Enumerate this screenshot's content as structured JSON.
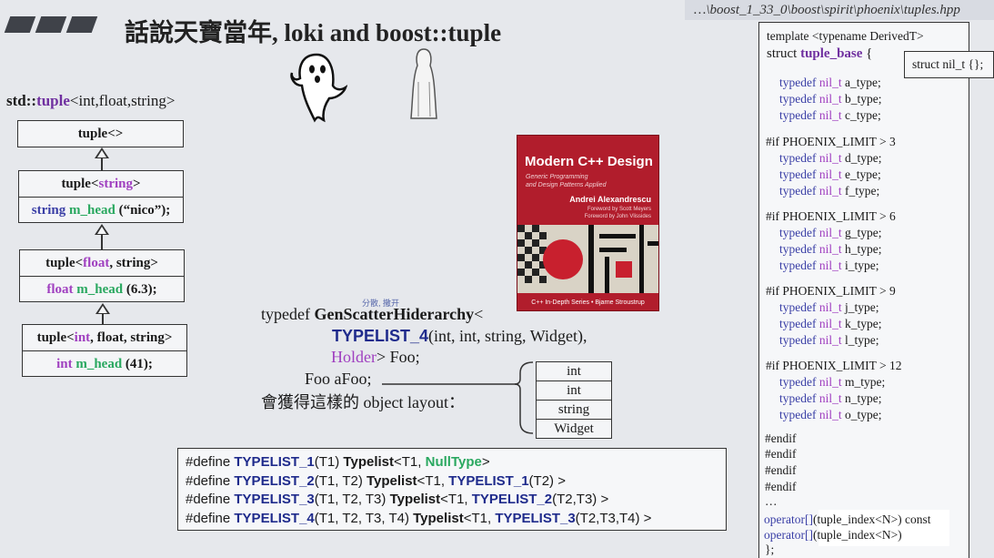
{
  "title": "話說天寶當年, loki and boost::tuple",
  "header_path": "…\\boost_1_33_0\\boost\\spirit\\phoenix\\tuples.hpp",
  "std_tuple": {
    "prefix": "std::",
    "kw": "tuple",
    "args": "<int,float,string>"
  },
  "hierarchy": {
    "root": "tuple<>",
    "level1": {
      "header_a": "tuple<",
      "header_b": "string",
      "header_c": ">",
      "member_type": "string",
      "member_name": "m_head",
      "member_init": "(“nico”);"
    },
    "level2": {
      "header_a": "tuple<",
      "header_b": "float",
      "header_c": ", string>",
      "member_type": "float",
      "member_name": "m_head",
      "member_init": "(6.3);"
    },
    "level3": {
      "header_a": "tuple<",
      "header_b": "int",
      "header_c": ", float, string>",
      "member_type": "int",
      "member_name": "m_head",
      "member_init": "(41);"
    }
  },
  "book": {
    "title": "Modern C++ Design",
    "subtitle_1": "Generic Programming",
    "subtitle_2": "and Design Patterns Applied",
    "author": "Andrei Alexandrescu",
    "foreword_1": "Foreword by Scott Meyers",
    "foreword_2": "Foreword by John Vlissides",
    "series": "C++ In-Depth Series • Bjarne Stroustrup"
  },
  "overlay_text": "分散, 撒开",
  "typedef_code": {
    "line1_a": "typedef ",
    "line1_b": "GenScatterHiderarchy",
    "line1_c": "<",
    "line2_a": "TYPELIST_4",
    "line2_b": "(int, int, string, Widget),",
    "line3_a": "Holder",
    "line3_b": ">  Foo;",
    "line4": "Foo aFoo;",
    "line5": "會獲得這樣的 object layout："
  },
  "object_layout": [
    "int",
    "int",
    "string",
    "Widget"
  ],
  "defines": [
    {
      "pre": "#define ",
      "name": "TYPELIST_1",
      "args": "(T1) ",
      "tl": "Typelist",
      "rest_a": "<T1, ",
      "ref": "NullType",
      "rest_b": ">"
    },
    {
      "pre": "#define ",
      "name": "TYPELIST_2",
      "args": "(T1, T2) ",
      "tl": "Typelist",
      "rest_a": "<T1, ",
      "ref": "TYPELIST_1",
      "rest_b": "(T2) >"
    },
    {
      "pre": "#define ",
      "name": "TYPELIST_3",
      "args": "(T1, T2, T3) ",
      "tl": "Typelist",
      "rest_a": "<T1, ",
      "ref": "TYPELIST_2",
      "rest_b": "(T2,T3) >"
    },
    {
      "pre": "#define ",
      "name": "TYPELIST_4",
      "args": "(T1, T2, T3, T4) ",
      "tl": "Typelist",
      "rest_a": "<T1, ",
      "ref": "TYPELIST_3",
      "rest_b": "(T2,T3,T4) >"
    }
  ],
  "right_panel": {
    "template_line": "template <typename DerivedT>",
    "struct_kw": "struct ",
    "struct_name": "tuple_base",
    "brace": " {",
    "nil_struct": "struct nil_t {};",
    "typedef_kw": "typedef",
    "nil_t": "nil_t",
    "groups": [
      {
        "cond": "",
        "types": [
          "a_type;",
          "b_type;",
          "c_type;"
        ]
      },
      {
        "cond": "#if PHOENIX_LIMIT > 3",
        "types": [
          "d_type;",
          "e_type;",
          "f_type;"
        ]
      },
      {
        "cond": "#if PHOENIX_LIMIT > 6",
        "types": [
          "g_type;",
          "h_type;",
          "i_type;"
        ]
      },
      {
        "cond": "#if PHOENIX_LIMIT > 9",
        "types": [
          "j_type;",
          "k_type;",
          "l_type;"
        ]
      },
      {
        "cond": "#if PHOENIX_LIMIT > 12",
        "types": [
          "m_type;",
          "n_type;",
          "o_type;"
        ]
      }
    ],
    "endifs": [
      "#endif",
      "#endif",
      "#endif",
      "#endif"
    ],
    "ellipsis": "…",
    "op_kw": "operator[]",
    "op1_rest": "(tuple_index<N>) const",
    "op2_rest": "(tuple_index<N>)",
    "close": "};"
  }
}
